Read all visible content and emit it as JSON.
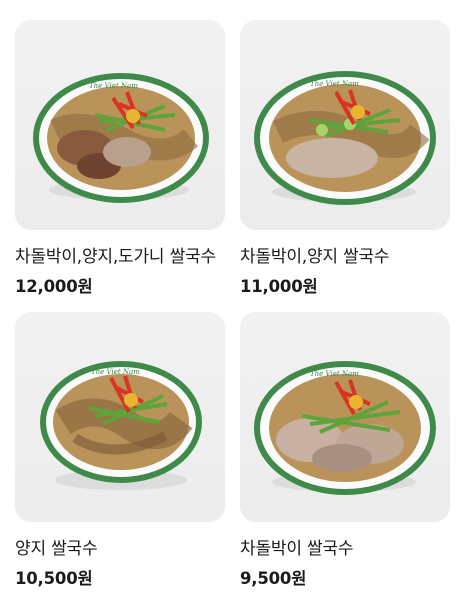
{
  "menu": {
    "items": [
      {
        "name": "차돌박이,양지,도가니 쌀국수",
        "price": "12,000원",
        "image_alt": "차돌박이 양지 도가니 쌀국수 사진"
      },
      {
        "name": "차돌박이,양지 쌀국수",
        "price": "11,000원",
        "image_alt": "차돌박이 양지 쌀국수 사진"
      },
      {
        "name": "양지 쌀국수",
        "price": "10,500원",
        "image_alt": "양지 쌀국수 사진"
      },
      {
        "name": "차돌박이 쌀국수",
        "price": "9,500원",
        "image_alt": "차돌박이 쌀국수 사진"
      }
    ],
    "bowl_logo": "The Viet Nam",
    "colors": {
      "bowl_rim_green": "#3f8a4a",
      "broth": "#b9935a",
      "noodles": "#8d6a3d",
      "chili_red": "#d8341f",
      "scallion_green": "#5fa33b",
      "photo_bg": "#efefef"
    }
  }
}
